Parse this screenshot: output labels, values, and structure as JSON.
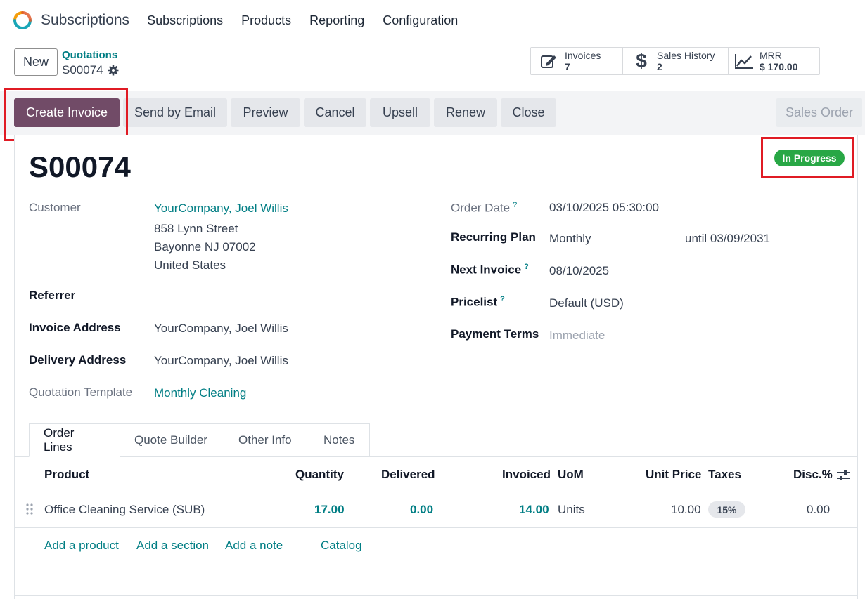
{
  "app": {
    "name": "Subscriptions"
  },
  "nav": [
    "Subscriptions",
    "Products",
    "Reporting",
    "Configuration"
  ],
  "control_panel": {
    "new_label": "New",
    "breadcrumb_parent": "Quotations",
    "breadcrumb_current": "S00074"
  },
  "smart_buttons": [
    {
      "label": "Invoices",
      "value": "7",
      "icon": "edit-icon"
    },
    {
      "label": "Sales History",
      "value": "2",
      "icon": "dollar-icon"
    },
    {
      "label": "MRR",
      "value": "$ 170.00",
      "icon": "chart-line-icon"
    }
  ],
  "actions": {
    "create_invoice": "Create Invoice",
    "send_email": "Send by Email",
    "preview": "Preview",
    "cancel": "Cancel",
    "upsell": "Upsell",
    "renew": "Renew",
    "close": "Close",
    "status": "Sales Order"
  },
  "record": {
    "title": "S00074",
    "state": "In Progress",
    "customer_label": "Customer",
    "customer": "YourCompany, Joel Willis",
    "address_1": "858 Lynn Street",
    "address_2": "Bayonne NJ 07002",
    "address_3": "United States",
    "referrer_label": "Referrer",
    "invoice_address_label": "Invoice Address",
    "invoice_address": "YourCompany, Joel Willis",
    "delivery_address_label": "Delivery Address",
    "delivery_address": "YourCompany, Joel Willis",
    "quotation_template_label": "Quotation Template",
    "quotation_template": "Monthly Cleaning",
    "order_date_label": "Order Date",
    "order_date": "03/10/2025 05:30:00",
    "recurring_plan_label": "Recurring Plan",
    "recurring_plan": "Monthly",
    "until": "until 03/09/2031",
    "next_invoice_label": "Next Invoice",
    "next_invoice": "08/10/2025",
    "pricelist_label": "Pricelist",
    "pricelist": "Default (USD)",
    "payment_terms_label": "Payment Terms",
    "payment_terms": "Immediate",
    "help_mark": "?"
  },
  "tabs": [
    "Order Lines",
    "Quote Builder",
    "Other Info",
    "Notes"
  ],
  "table": {
    "headers": {
      "product": "Product",
      "quantity": "Quantity",
      "delivered": "Delivered",
      "invoiced": "Invoiced",
      "uom": "UoM",
      "unit_price": "Unit Price",
      "taxes": "Taxes",
      "disc": "Disc.%"
    },
    "rows": [
      {
        "product": "Office Cleaning Service (SUB)",
        "quantity": "17.00",
        "delivered": "0.00",
        "invoiced": "14.00",
        "uom": "Units",
        "unit_price": "10.00",
        "taxes": "15%",
        "disc": "0.00"
      }
    ],
    "add_links": [
      "Add a product",
      "Add a section",
      "Add a note",
      "Catalog"
    ]
  }
}
